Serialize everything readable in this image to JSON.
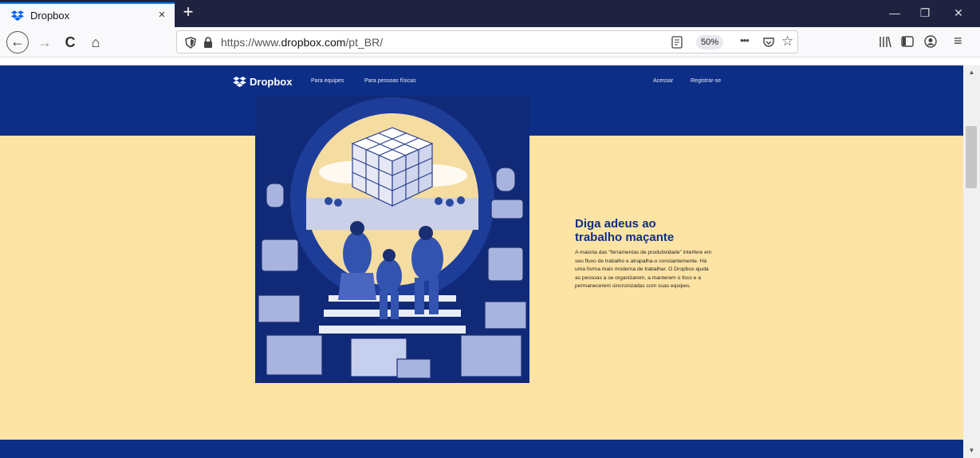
{
  "browser": {
    "tab": {
      "title": "Dropbox",
      "close_glyph": "×"
    },
    "new_tab_glyph": "+",
    "window_controls": {
      "minimize": "—",
      "restore": "❐",
      "close": "✕"
    },
    "nav": {
      "back": "←",
      "forward": "→",
      "reload": "C",
      "home": "⌂"
    },
    "url": {
      "prefix": "https://www.",
      "domain": "dropbox.com",
      "path": "/pt_BR/"
    },
    "zoom": "50%",
    "page_actions": "•••",
    "accent": "#0a84ff"
  },
  "site": {
    "brand": "Dropbox",
    "nav_links": [
      "Para equipes",
      "Para pessoas físicas"
    ],
    "account_links": [
      "Acessar",
      "Registrar-se"
    ],
    "hero": {
      "headline": "Diga adeus ao\ntrabalho maçante",
      "body": "A maioria das “ferramentas de produtividade” interfere em seu fluxo de trabalho e atrapalha-o constantemente. Há uma forma mais moderna de trabalhar. O Dropbox ajuda as pessoas a se organizarem, a manterem o foco e a permanecerem sincronizadas com suas equipes."
    },
    "colors": {
      "primary": "#0d2e86",
      "hero_bg": "#fde4a5"
    }
  }
}
